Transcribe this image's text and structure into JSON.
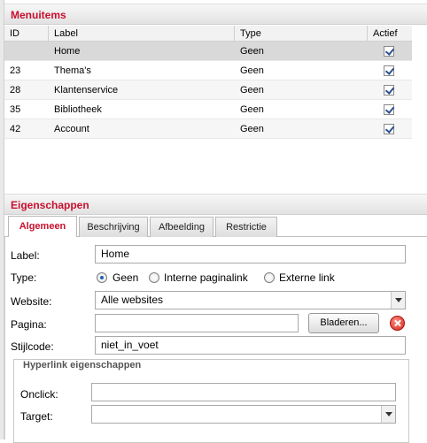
{
  "menuitems": {
    "title": "Menuitems",
    "columns": [
      "ID",
      "Label",
      "Type",
      "Actief"
    ],
    "rows": [
      {
        "id": "",
        "label": "Home",
        "type": "Geen",
        "actief": true
      },
      {
        "id": "23",
        "label": "Thema's",
        "type": "Geen",
        "actief": true
      },
      {
        "id": "28",
        "label": "Klantenservice",
        "type": "Geen",
        "actief": true
      },
      {
        "id": "35",
        "label": "Bibliotheek",
        "type": "Geen",
        "actief": true
      },
      {
        "id": "42",
        "label": "Account",
        "type": "Geen",
        "actief": true
      }
    ]
  },
  "properties": {
    "title": "Eigenschappen",
    "tabs": [
      "Algemeen",
      "Beschrijving",
      "Afbeelding",
      "Restrictie"
    ],
    "active_tab": "Algemeen",
    "label_field": {
      "label": "Label:",
      "value": "Home"
    },
    "type_field": {
      "label": "Type:",
      "options": [
        "Geen",
        "Interne paginalink",
        "Externe link"
      ],
      "selected": "Geen"
    },
    "website_field": {
      "label": "Website:",
      "value": "Alle websites"
    },
    "pagina_field": {
      "label": "Pagina:",
      "value": "",
      "browse_button": "Bladeren..."
    },
    "stijlcode_field": {
      "label": "Stijlcode:",
      "value": "niet_in_voet"
    },
    "hyperlink": {
      "legend": "Hyperlink eigenschappen",
      "onclick": {
        "label": "Onclick:",
        "value": ""
      },
      "target": {
        "label": "Target:",
        "value": ""
      }
    }
  },
  "colors": {
    "accent": "#c8102e",
    "selected_row": "#d9d9d9"
  }
}
